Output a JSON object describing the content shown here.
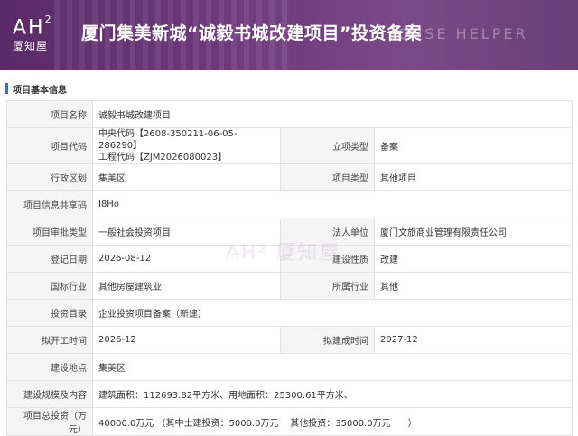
{
  "banner": {
    "logo_ah": "AH",
    "logo_sup": "2",
    "logo_sub": "厦知屋",
    "title": "厦门集美新城“诚毅书城改建项目”投资备案",
    "helper": "OUSE HELPER"
  },
  "section": {
    "title": "项目基本信息"
  },
  "rows": [
    {
      "l1": "项目名称",
      "v1": "诚毅书城改建项目"
    },
    {
      "l1": "项目代码",
      "v1a": "中央代码【2608-350211-06-05-286290】",
      "v1b": "工程代码【ZJM2026080023】",
      "l2": "立项类型",
      "v2": "备案"
    },
    {
      "l1": "行政区划",
      "v1": "集美区",
      "l2": "项目类型",
      "v2": "其他项目"
    },
    {
      "l1": "项目信息共享码",
      "v1": "I8Ho"
    },
    {
      "l1": "项目审批类型",
      "v1": "一般社会投资项目",
      "l2": "法人单位",
      "v2": "厦门文旅商业管理有限责任公司"
    },
    {
      "l1": "登记日期",
      "v1": "2026-08-12",
      "l2": "建设性质",
      "v2": "改建"
    },
    {
      "l1": "国标行业",
      "v1": "其他房屋建筑业",
      "l2": "所属行业",
      "v2": "其他"
    },
    {
      "l1": "投资目录",
      "v1": "企业投资项目备案（新建）"
    },
    {
      "l1": "拟开工时间",
      "v1": "2026-12",
      "l2": "拟建成时间",
      "v2": "2027-12"
    },
    {
      "l1": "建设地点",
      "v1": "集美区"
    },
    {
      "l1": "建设规模及内容",
      "v1": "建筑面积：112693.82平方米、用地面积：25300.61平方米、"
    },
    {
      "l1": "项目总投资（万元）",
      "v1": "40000.0万元 （其中土建投资：5000.0万元    其他投资：35000.0万元      ）"
    }
  ],
  "watermark": "AH² 厦知屋"
}
